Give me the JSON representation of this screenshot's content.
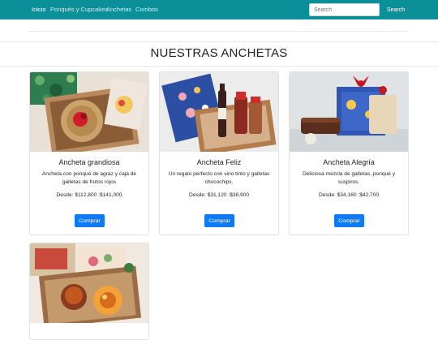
{
  "navbar": {
    "links": [
      {
        "label": "Inicio",
        "active": true
      },
      {
        "label": "Ponqués y Cupcakes",
        "active": false
      },
      {
        "label": "Anchetas",
        "active": false
      },
      {
        "label": "Combos",
        "active": false
      }
    ],
    "search": {
      "placeholder": "Search",
      "button_label": "Search"
    },
    "colors": {
      "bar": "#0b8f98",
      "link": "#cfeef0",
      "active_link": "#ffffff"
    }
  },
  "main": {
    "title": "NUESTRAS ANCHETAS",
    "products": [
      {
        "name": "Ancheta grandiosa",
        "description": "Ancheta con ponqué de agraz y caja de galletas de frutos rojos",
        "price": "Desde: $112,800 :$141,000",
        "button_label": "Comprar"
      },
      {
        "name": "Ancheta Feliz",
        "description": "Un regalo perfecto con vino tinto y galletas chocochips.",
        "price": "Desde: $31,120 :$38,900",
        "button_label": "Comprar"
      },
      {
        "name": "Ancheta Alegría",
        "description": "Deliciosa mezcla de galletas, ponqué y suspiros.",
        "price": "Desde: $34,160 :$42,700",
        "button_label": "Comprar"
      },
      {
        "name": "",
        "description": "",
        "price": "",
        "button_label": ""
      }
    ],
    "colors": {
      "buy_button": "#0d7bf5"
    }
  }
}
